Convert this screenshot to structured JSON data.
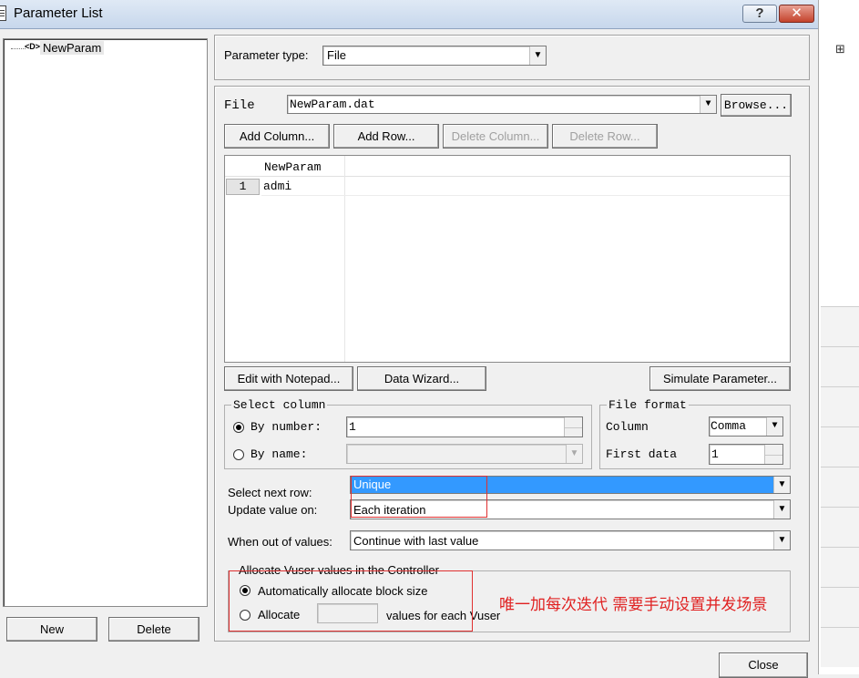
{
  "window": {
    "title": "Parameter List",
    "help": "?",
    "close": "✕"
  },
  "tree": {
    "node_icon": "<D>",
    "node_label": "NewParam"
  },
  "left_buttons": {
    "new": "New",
    "delete": "Delete"
  },
  "param_type": {
    "label": "Parameter type:",
    "value": "File"
  },
  "file": {
    "label": "File",
    "value": "NewParam.dat",
    "browse": "Browse...",
    "add_column": "Add Column...",
    "add_row": "Add Row...",
    "delete_column": "Delete Column...",
    "delete_row": "Delete Row..."
  },
  "table": {
    "header": "NewParam",
    "rows": [
      {
        "num": "1",
        "value": "admi"
      }
    ]
  },
  "grid_buttons": {
    "edit_notepad": "Edit with Notepad...",
    "data_wizard": "Data Wizard...",
    "simulate": "Simulate Parameter..."
  },
  "select_column": {
    "title": "Select column",
    "by_number_label": "By number:",
    "by_number_value": "1",
    "by_name_label": "By name:"
  },
  "file_format": {
    "title": "File format",
    "column_label": "Column",
    "column_value": "Comma",
    "first_data_label": "First data",
    "first_data_value": "1"
  },
  "select_next_row": {
    "label": "Select next row:",
    "value": "Unique"
  },
  "update_value_on": {
    "label": "Update value on:",
    "value": "Each iteration"
  },
  "out_of_values": {
    "label": "When out of values:",
    "value": "Continue with last value"
  },
  "allocate": {
    "title": "Allocate Vuser values in the Controller",
    "auto_label": "Automatically allocate block size",
    "manual_label": "Allocate",
    "suffix": "values for each Vuser"
  },
  "annotation": {
    "text": "唯一加每次迭代 需要手动设置并发场景",
    "color": "#e02020"
  },
  "close_button": "Close",
  "colors": {
    "selection": "#3399ff",
    "annotation_box": "#e03030"
  }
}
